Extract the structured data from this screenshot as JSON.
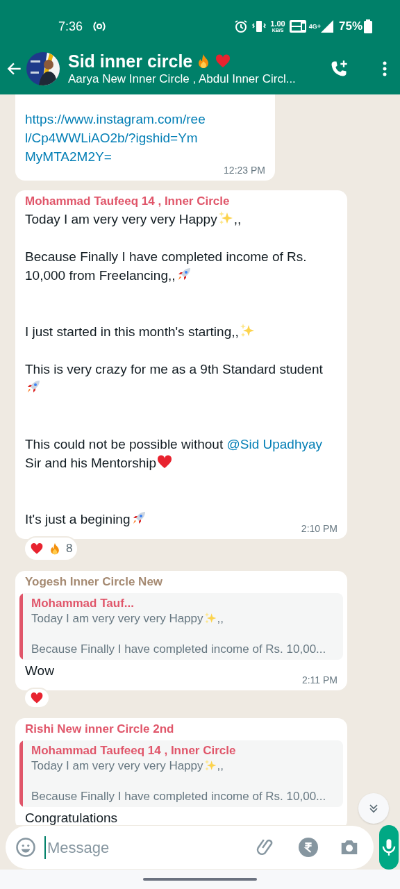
{
  "status_bar": {
    "time": "7:36",
    "speed_value": "1.00",
    "speed_unit": "KB/S",
    "network": "4G+",
    "battery": "75%"
  },
  "header": {
    "title": "Sid inner circle",
    "title_emoji": [
      {
        "kind": "fire"
      },
      {
        "kind": "heart"
      }
    ],
    "subtitle": "Aarya New Inner Circle , Abdul Inner Circl..."
  },
  "messages": [
    {
      "kind": "partial",
      "body": [
        {
          "kind": "link",
          "text": "https://www.instagram.com/reel/Cp4WWLiAO2b/?igshid=YmMyMTA2M2Y="
        }
      ],
      "time": "12:23 PM"
    },
    {
      "kind": "text",
      "sender": "Mohammad Taufeeq 14 , Inner Circle",
      "color": "#e0566a",
      "body": [
        {
          "kind": "para",
          "parts": [
            {
              "kind": "text",
              "text": "Today I am very very very Happy"
            },
            {
              "kind": "sparkles"
            },
            {
              "kind": "text",
              "text": ",,"
            }
          ]
        },
        {
          "kind": "blank"
        },
        {
          "kind": "para",
          "parts": [
            {
              "kind": "text",
              "text": "Because Finally I have completed income of Rs. 10,000 from Freelancing,,"
            },
            {
              "kind": "rocket"
            }
          ]
        },
        {
          "kind": "blank"
        },
        {
          "kind": "blank"
        },
        {
          "kind": "para",
          "parts": [
            {
              "kind": "text",
              "text": "I just started in this month's starting,,"
            },
            {
              "kind": "sparkles"
            }
          ]
        },
        {
          "kind": "blank"
        },
        {
          "kind": "para",
          "parts": [
            {
              "kind": "text",
              "text": "This is very crazy for me as a 9th Standard student"
            },
            {
              "kind": "rocket"
            }
          ]
        },
        {
          "kind": "blank"
        },
        {
          "kind": "blank"
        },
        {
          "kind": "para",
          "parts": [
            {
              "kind": "text",
              "text": "This could not be possible without "
            },
            {
              "kind": "mention",
              "text": "@Sid Upadhyay"
            },
            {
              "kind": "text",
              "text": " Sir and his Mentorship"
            },
            {
              "kind": "heart"
            }
          ]
        },
        {
          "kind": "blank"
        },
        {
          "kind": "blank"
        },
        {
          "kind": "para",
          "parts": [
            {
              "kind": "text",
              "text": "It's just a begining"
            },
            {
              "kind": "rocket"
            }
          ]
        }
      ],
      "time": "2:10 PM",
      "reactions": {
        "emoji": [
          {
            "kind": "heart"
          },
          {
            "kind": "fire"
          }
        ],
        "count": "8"
      }
    },
    {
      "kind": "reply",
      "sender": "Yogesh Inner Circle New",
      "color": "#a58a72",
      "quote": {
        "author": "Mohammad Tauf...",
        "color": "#e0566a",
        "first": [
          {
            "kind": "text",
            "text": "Today I am very very very Happy"
          },
          {
            "kind": "sparkles"
          },
          {
            "kind": "text",
            "text": ",,"
          }
        ],
        "second": "Because Finally I have completed income of Rs. 10,00..."
      },
      "text": "Wow",
      "time": "2:11 PM",
      "reactions": {
        "emoji": [
          {
            "kind": "heart"
          }
        ]
      }
    },
    {
      "kind": "reply",
      "sender": "Rishi New inner Circle 2nd",
      "color": "#e0566a",
      "quote": {
        "author": "Mohammad Taufeeq 14 , Inner Circle",
        "color": "#e0566a",
        "first": [
          {
            "kind": "text",
            "text": "Today I am very very very Happy"
          },
          {
            "kind": "sparkles"
          },
          {
            "kind": "text",
            "text": ",,"
          }
        ],
        "second": "Because Finally I have completed income of Rs. 10,00..."
      },
      "text": "Congratulations"
    }
  ],
  "composer": {
    "placeholder": "Message"
  }
}
